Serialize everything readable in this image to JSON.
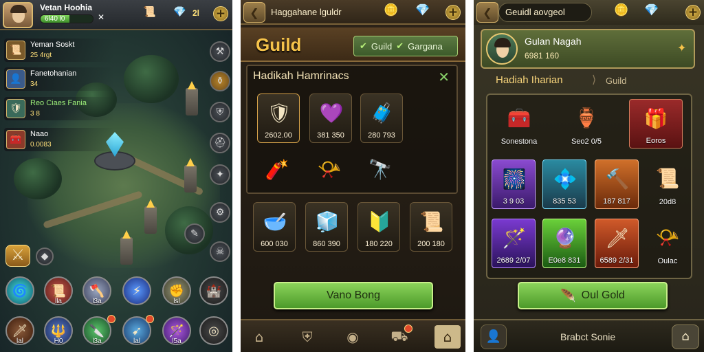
{
  "colors": {
    "accent_gold": "#f6c34a",
    "button_green": "#6ab843",
    "panel_brown": "#3c2a16"
  },
  "panel1": {
    "player_name": "Vetan Hoohia",
    "xp_text": "6l40 l0",
    "xp_fraction": 0.55,
    "resource_count": "2l",
    "quests": [
      {
        "title": "Yeman Soskt",
        "sub": "25 4rgt",
        "icon": "scroll-icon"
      },
      {
        "title": "Fanetohanian",
        "sub": "34",
        "icon": "hero-portrait-icon"
      },
      {
        "title": "Reo Ciaes Fania",
        "sub": "3 8",
        "icon": "knight-portrait-icon"
      },
      {
        "title": "Naao",
        "sub": "0.0083",
        "icon": "chest-icon"
      }
    ],
    "skills_row1": [
      {
        "count": "",
        "icon": "swirl-icon"
      },
      {
        "count": "lla",
        "icon": "scroll-icon"
      },
      {
        "count": "l3a",
        "icon": "axe-icon"
      },
      {
        "count": "",
        "icon": "lightning-icon"
      },
      {
        "count": "lsl",
        "icon": "fist-icon"
      }
    ],
    "skills_row2": [
      {
        "count": "lal",
        "icon": "sword-icon"
      },
      {
        "count": "H0",
        "icon": "staff-icon"
      },
      {
        "count": "l3a",
        "icon": "dagger-icon"
      },
      {
        "count": "lal",
        "icon": "arrow-icon"
      },
      {
        "count": "l5a",
        "icon": "wand-icon"
      }
    ]
  },
  "panel2": {
    "header_title": "Haggahane lguldr",
    "guild_title": "Guild",
    "tab_label": "Guild",
    "tab_label2": "Gargana",
    "card_title": "Hadikah Hamrinacs",
    "top_rewards": [
      {
        "value": "2602.00",
        "icon": "shield-chest-icon"
      },
      {
        "value": "381 350",
        "icon": "gem-frame-icon"
      },
      {
        "value": "280 793",
        "icon": "armor-chest-icon"
      }
    ],
    "bottom_rewards": [
      {
        "value": "600 030",
        "icon": "blue-cauldron-icon"
      },
      {
        "value": "860 390",
        "icon": "blue-chest-icon"
      },
      {
        "value": "180 220",
        "icon": "gold-shield-icon"
      },
      {
        "value": "200 180",
        "icon": "gold-scroll-icon"
      }
    ],
    "action_button": "Vano Bong"
  },
  "panel3": {
    "header_title": "Geuidl aovgeol",
    "guild_name": "Gulan Nagah",
    "guild_id": "6981 160",
    "tab_active": "Hadiah Iharian",
    "tab_inactive": "Guild",
    "row1": [
      {
        "label": "Sonestona",
        "icon": "gold-chest-icon"
      },
      {
        "label": "Seo2 0/5",
        "icon": "gold-pot-icon"
      },
      {
        "label": "Eoros",
        "icon": "gift-box-icon"
      }
    ],
    "row2": [
      {
        "label": "3 9 03",
        "icon": "purple-chest-icon"
      },
      {
        "label": "835 53",
        "icon": "blue-crystal-chest-icon"
      },
      {
        "label": "187 817",
        "icon": "hammer-icon"
      },
      {
        "label": "20d8",
        "icon": "gold-scroll-icon"
      }
    ],
    "row3": [
      {
        "label": "2689 2/07",
        "icon": "purple-box-icon"
      },
      {
        "label": "E0e8 831",
        "icon": "green-crystal-icon"
      },
      {
        "label": "6589 2/31",
        "icon": "fire-sword-icon"
      },
      {
        "label": "Oulac",
        "icon": "gold-scroll-icon"
      }
    ],
    "action_button": "Oul Gold",
    "footer_text": "Brabct Sonie"
  }
}
